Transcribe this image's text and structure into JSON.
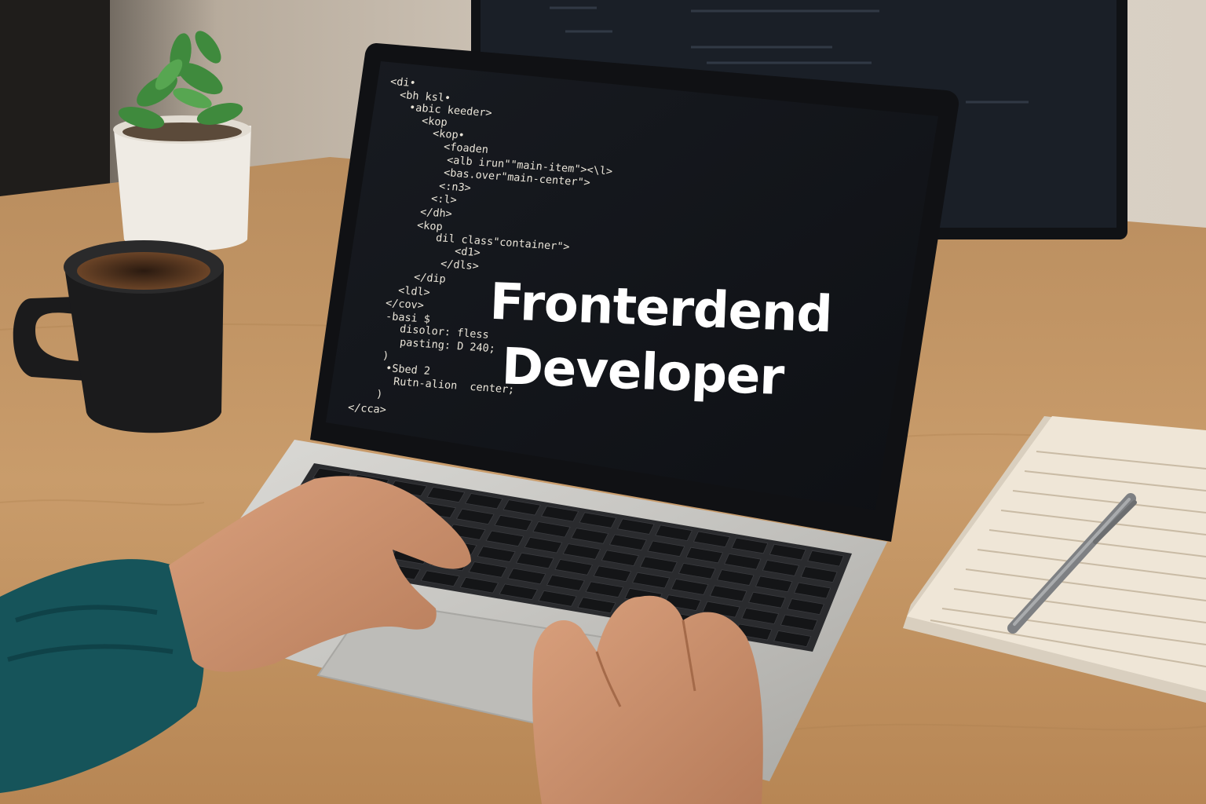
{
  "screen": {
    "headline_line1": "Fronterdend",
    "headline_line2": "Developer",
    "code_lines": [
      "<di•",
      "<bh ksl•",
      "•abic keeder>",
      "<kop",
      "<kop•",
      "<foaden",
      "<alb irun\"\"main-item\"><\\l>",
      "<bas.over\"main-center\">",
      "<:n3>",
      "<:l>",
      "</dh>",
      "<kop",
      "dil class\"container\">",
      "<d1>",
      "</dls>",
      "</dip",
      "<ldl>",
      "</cov>",
      "-basi $",
      "disolor: fless",
      "pasting: D 240;",
      ")",
      "•Sbed 2",
      "Rutn-alion  center;",
      ")",
      "</cca>"
    ]
  },
  "colors": {
    "wall": "#d9cfc2",
    "desk": "#c89a68",
    "screen_bg": "#121419",
    "laptop_shell": "#c9c8c4",
    "sweater": "#16545a",
    "skin": "#c98f6c",
    "mug": "#1b1b1c",
    "plant_pot": "#efebe4",
    "notebook": "#efe6d7",
    "pen": "#8b8d8f"
  }
}
